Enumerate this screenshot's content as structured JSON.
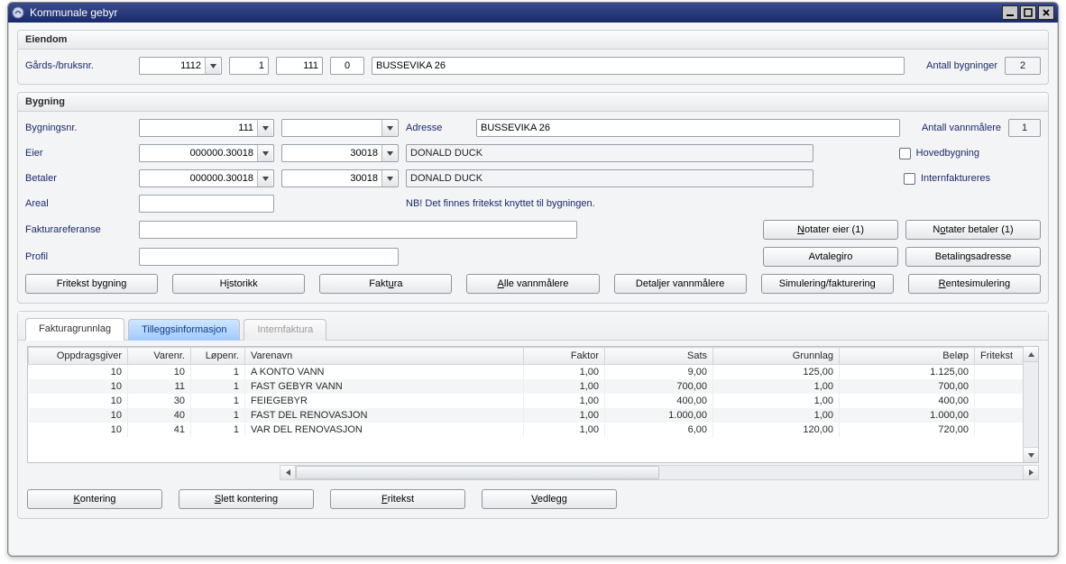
{
  "window": {
    "title": "Kommunale gebyr"
  },
  "eiendom": {
    "group_label": "Eiendom",
    "gards_label": "Gårds-/bruksnr.",
    "gards_nr": "1112",
    "bruks_nr": "1",
    "feste_nr": "111",
    "seksjons_nr": "0",
    "adresse": "BUSSEVIKA 26",
    "antall_bygninger_label": "Antall bygninger",
    "antall_bygninger": "2"
  },
  "bygning": {
    "group_label": "Bygning",
    "bygningsnr_label": "Bygningsnr.",
    "bygningsnr": "111",
    "bygningsnr2": "",
    "adresse_label": "Adresse",
    "adresse": "BUSSEVIKA 26",
    "antall_vm_label": "Antall vannmålere",
    "antall_vm": "1",
    "eier_label": "Eier",
    "eier_id": "000000.30018",
    "eier_nr": "30018",
    "eier_navn": "DONALD DUCK",
    "hovedbygning_label": "Hovedbygning",
    "betaler_label": "Betaler",
    "betaler_id": "000000.30018",
    "betaler_nr": "30018",
    "betaler_navn": "DONALD DUCK",
    "internfakt_label": "Internfaktureres",
    "areal_label": "Areal",
    "areal": "",
    "note": "NB! Det finnes fritekst knyttet til bygningen.",
    "fakturaref_label": "Fakturareferanse",
    "fakturaref": "",
    "profil_label": "Profil",
    "profil": ""
  },
  "buttons": {
    "notater_eier": "Notater eier (1)",
    "notater_betaler": "Notater betaler (1)",
    "avtalegiro": "Avtalegiro",
    "betalingsadresse": "Betalingsadresse",
    "fritekst_bygning": "Fritekst bygning",
    "historikk": "Historikk",
    "faktura": "Faktura",
    "alle_vm": "Alle vannmålere",
    "detaljer_vm": "Detaljer vannmålere",
    "simulering": "Simulering/fakturering",
    "rentesimulering": "Rentesimulering",
    "kontering": "Kontering",
    "slett_kontering": "Slett kontering",
    "fritekst": "Fritekst",
    "vedlegg": "Vedlegg"
  },
  "tabs": {
    "fakturagrunnlag": "Fakturagrunnlag",
    "tillegg": "Tilleggsinformasjon",
    "internfaktura": "Internfaktura"
  },
  "grid": {
    "headers": {
      "oppdragsgiver": "Oppdragsgiver",
      "varenr": "Varenr.",
      "lopenr": "Løpenr.",
      "varenavn": "Varenavn",
      "faktor": "Faktor",
      "sats": "Sats",
      "grunnlag": "Grunnlag",
      "belop": "Beløp",
      "fritekst": "Fritekst"
    },
    "rows": [
      {
        "oppdragsgiver": "10",
        "varenr": "10",
        "lopenr": "1",
        "varenavn": "A KONTO VANN",
        "faktor": "1,00",
        "sats": "9,00",
        "grunnlag": "125,00",
        "belop": "1.125,00",
        "fritekst": ""
      },
      {
        "oppdragsgiver": "10",
        "varenr": "11",
        "lopenr": "1",
        "varenavn": "FAST GEBYR VANN",
        "faktor": "1,00",
        "sats": "700,00",
        "grunnlag": "1,00",
        "belop": "700,00",
        "fritekst": ""
      },
      {
        "oppdragsgiver": "10",
        "varenr": "30",
        "lopenr": "1",
        "varenavn": "FEIEGEBYR",
        "faktor": "1,00",
        "sats": "400,00",
        "grunnlag": "1,00",
        "belop": "400,00",
        "fritekst": ""
      },
      {
        "oppdragsgiver": "10",
        "varenr": "40",
        "lopenr": "1",
        "varenavn": "FAST DEL  RENOVASJON",
        "faktor": "1,00",
        "sats": "1.000,00",
        "grunnlag": "1,00",
        "belop": "1.000,00",
        "fritekst": ""
      },
      {
        "oppdragsgiver": "10",
        "varenr": "41",
        "lopenr": "1",
        "varenavn": "VAR DEL RENOVASJON",
        "faktor": "1,00",
        "sats": "6,00",
        "grunnlag": "120,00",
        "belop": "720,00",
        "fritekst": ""
      }
    ]
  }
}
